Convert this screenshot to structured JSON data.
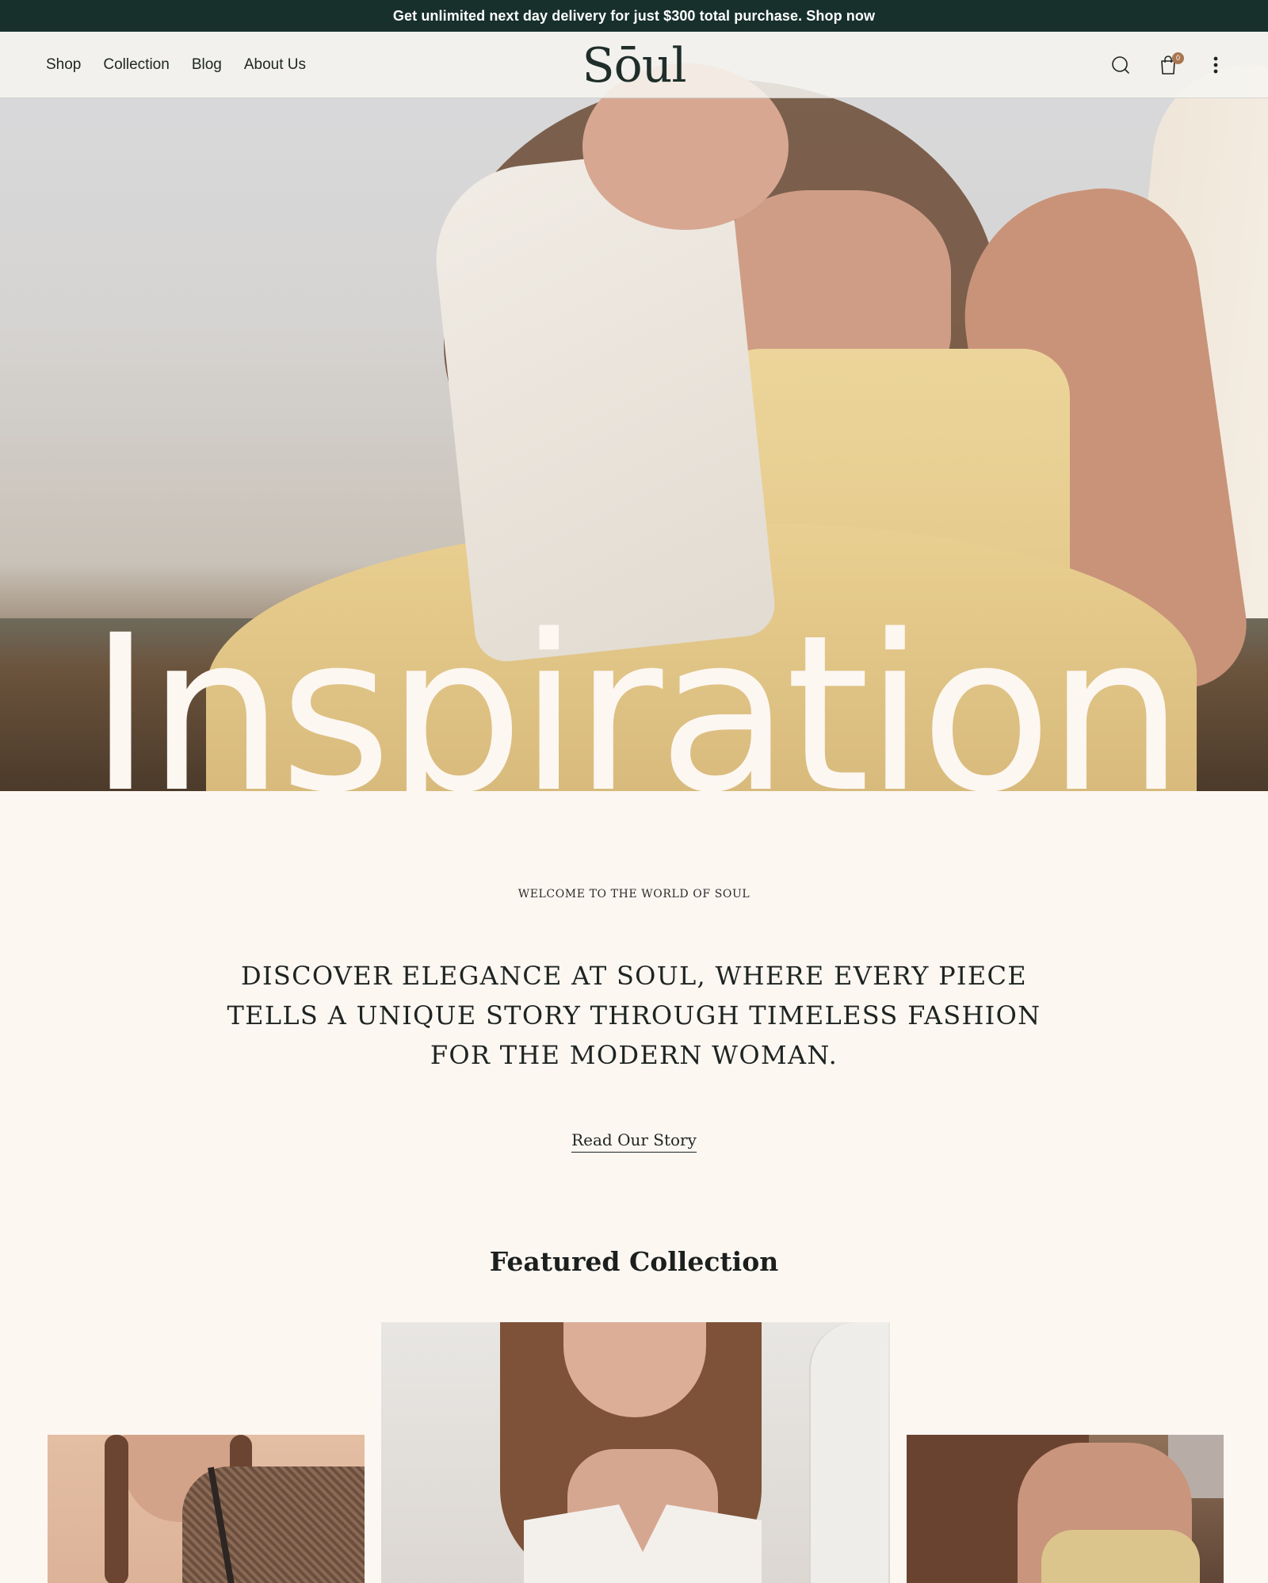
{
  "announcement": {
    "text": "Get unlimited next day delivery for just $300 total purchase. Shop now"
  },
  "nav": {
    "links": [
      "Shop",
      "Collection",
      "Blog",
      "About Us"
    ],
    "logo": "Sōul",
    "cart_count": "0",
    "icons": [
      "search-icon",
      "bag-icon",
      "more-vertical-icon"
    ]
  },
  "hero": {
    "title": "Inspiration"
  },
  "intro": {
    "eyebrow": "WELCOME TO THE WORLD OF SOUL",
    "statement": "DISCOVER ELEGANCE AT SOUL, WHERE EVERY PIECE TELLS A UNIQUE STORY THROUGH TIMELESS FASHION FOR THE MODERN WOMAN.",
    "story_link": "Read Our Story"
  },
  "featured": {
    "title": "Featured Collection"
  },
  "colors": {
    "announce_bg": "#17302b",
    "page_bg": "#fdf7f2",
    "text": "#1d2523",
    "accent": "#a97550"
  }
}
